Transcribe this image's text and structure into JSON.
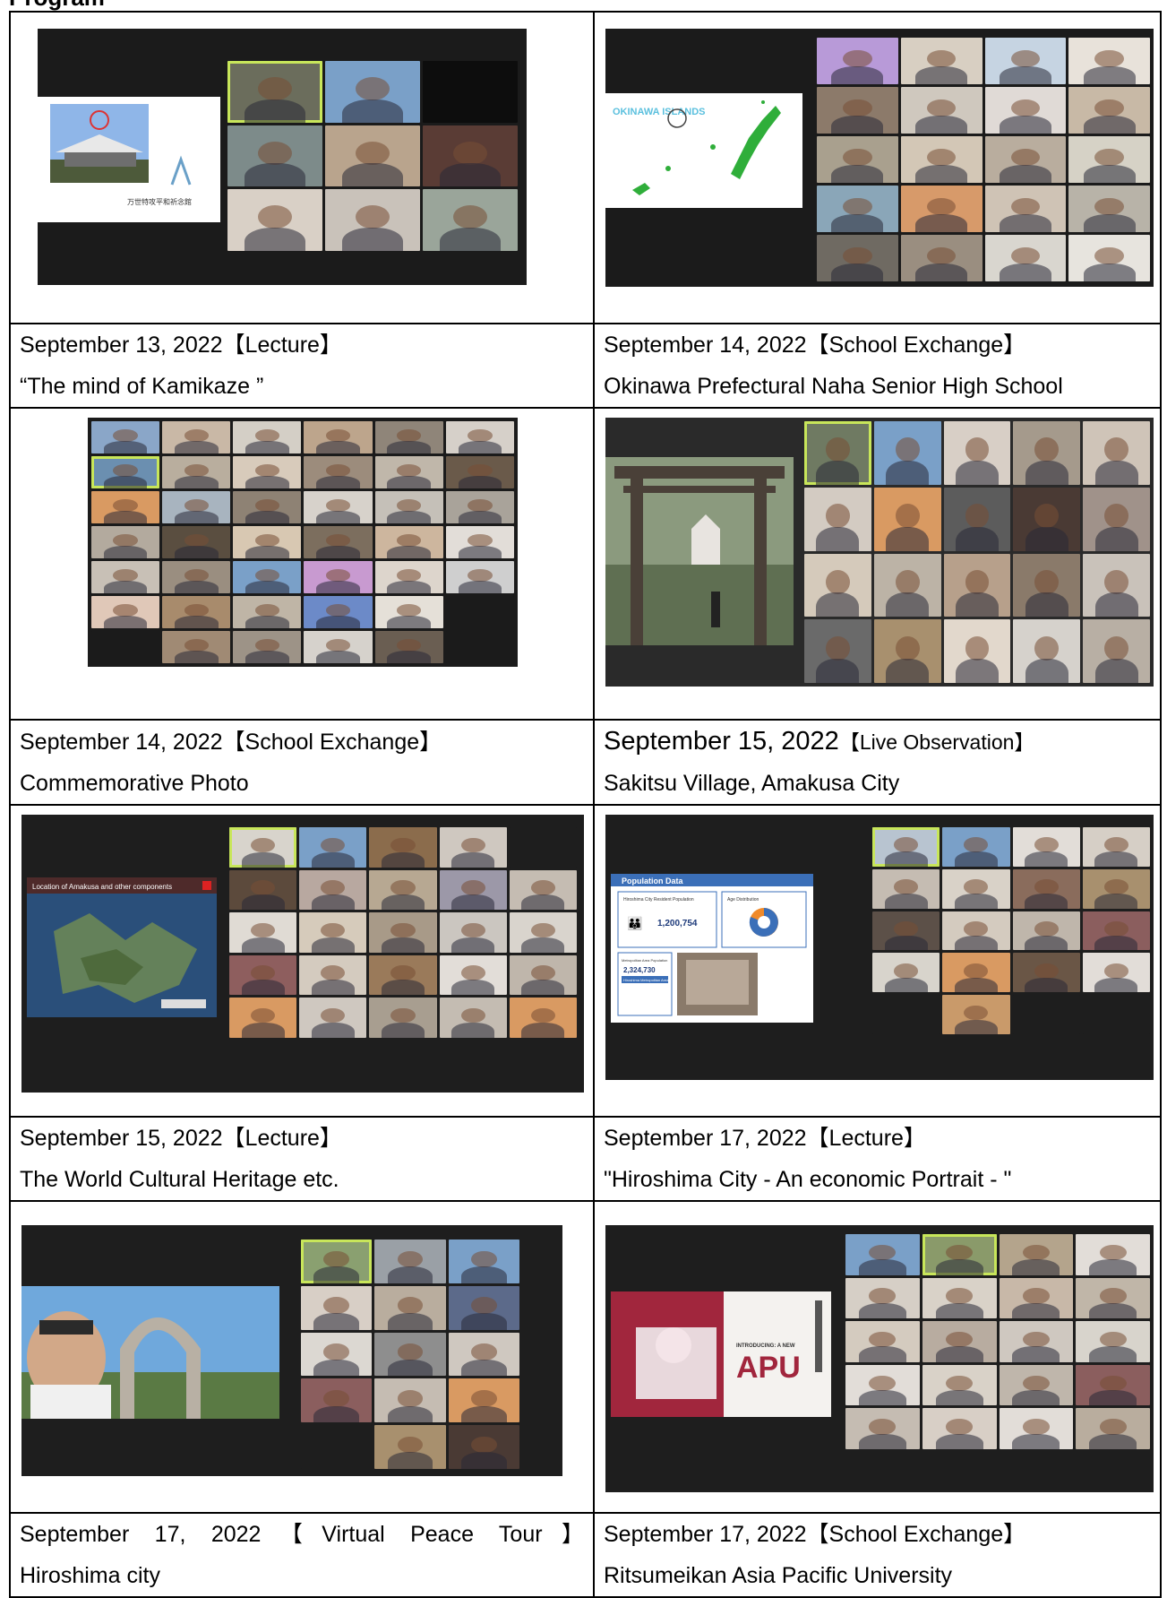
{
  "header": {
    "title": "Program"
  },
  "rows": [
    {
      "left": {
        "lines": [
          "September 13, 2022【Lecture】",
          "“The mind of Kamikaze ”"
        ]
      },
      "right": {
        "lines": [
          "September 14, 2022【School Exchange】",
          "Okinawa Prefectural Naha Senior High School"
        ]
      }
    },
    {
      "left": {
        "lines": [
          "September 14, 2022【School Exchange】",
          "Commemorative Photo"
        ]
      },
      "right": {
        "line1_date": "September 15, 2022",
        "line1_tag": "【Live Observation】",
        "line2": "Sakitsu Village, Amakusa City"
      }
    },
    {
      "left": {
        "lines": [
          "September 15, 2022【Lecture】",
          "The World Cultural Heritage etc."
        ]
      },
      "right": {
        "lines": [
          "September 17, 2022【Lecture】",
          "\"Hiroshima City - An economic Portrait - \""
        ]
      }
    },
    {
      "left": {
        "lines": [
          "September 17, 2022【Virtual Peace Tour】",
          "Hiroshima city"
        ]
      },
      "right": {
        "lines": [
          "September 17, 2022【School Exchange】",
          "Ritsumeikan Asia Pacific University"
        ]
      }
    }
  ],
  "slides": {
    "kamikaze": {
      "label": "万世特攻平和祈念館"
    },
    "okinawa": {
      "title": "OKINAWA ISLANDS"
    },
    "amakusa": {
      "title": "Location of Amakusa and other components"
    },
    "population": {
      "title": "Population Data",
      "resident_label": "Hiroshima City Resident Population",
      "resident_value": "1,200,754",
      "age_label": "Age Distribution",
      "metro_label": "Metropolitan Area Population",
      "metro_value": "2,324,730",
      "metro_box": "Hiroshima Metropolitan Area"
    },
    "apu": {
      "intro": "INTRODUCING: A NEW",
      "name": "APU"
    }
  },
  "colors": {
    "grid_bg": "#1b1b1b",
    "highlight": "#c8e65a",
    "apu_red": "#a1263d",
    "okinawa_green": "#2fae3a"
  }
}
